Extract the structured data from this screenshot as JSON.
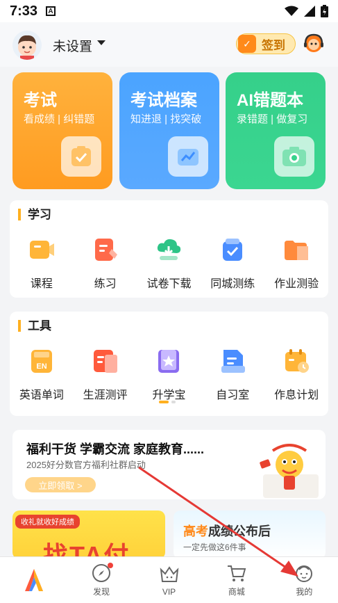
{
  "status_bar": {
    "time": "7:33",
    "badge": "A"
  },
  "header": {
    "username": "未设置",
    "checkin_label": "签到"
  },
  "cards": [
    {
      "title": "考试",
      "subtitle_a": "看成绩",
      "subtitle_b": "纠错题"
    },
    {
      "title": "考试档案",
      "subtitle_a": "知进退",
      "subtitle_b": "找突破"
    },
    {
      "title": "AI错题本",
      "subtitle_a": "录错题",
      "subtitle_b": "做复习"
    }
  ],
  "study": {
    "title": "学习",
    "items": [
      "课程",
      "练习",
      "试卷下载",
      "同城测练",
      "作业测验"
    ]
  },
  "tools": {
    "title": "工具",
    "items": [
      "英语单词",
      "生涯测评",
      "升学宝",
      "自习室",
      "作息计划"
    ],
    "en_badge": "EN"
  },
  "promo": {
    "title": "福利干货 学霸交流 家庭教育......",
    "subtitle": "2025好分数官方福利社群启动",
    "button": "立即领取 >"
  },
  "banner_left": {
    "tag": "收礼就收好成绩",
    "headline": "找TA付"
  },
  "banner_right": {
    "highlight": "高考",
    "title_rest": "成绩公布后",
    "subtitle": "一定先做这6件事"
  },
  "tabbar": {
    "items": [
      "发现",
      "VIP",
      "商城",
      "我的"
    ]
  },
  "colors": {
    "accent": "#ffb020",
    "exam": "#ffa52e",
    "archive": "#4ea6ff",
    "ai": "#38d38d",
    "arrow": "#e53935"
  }
}
